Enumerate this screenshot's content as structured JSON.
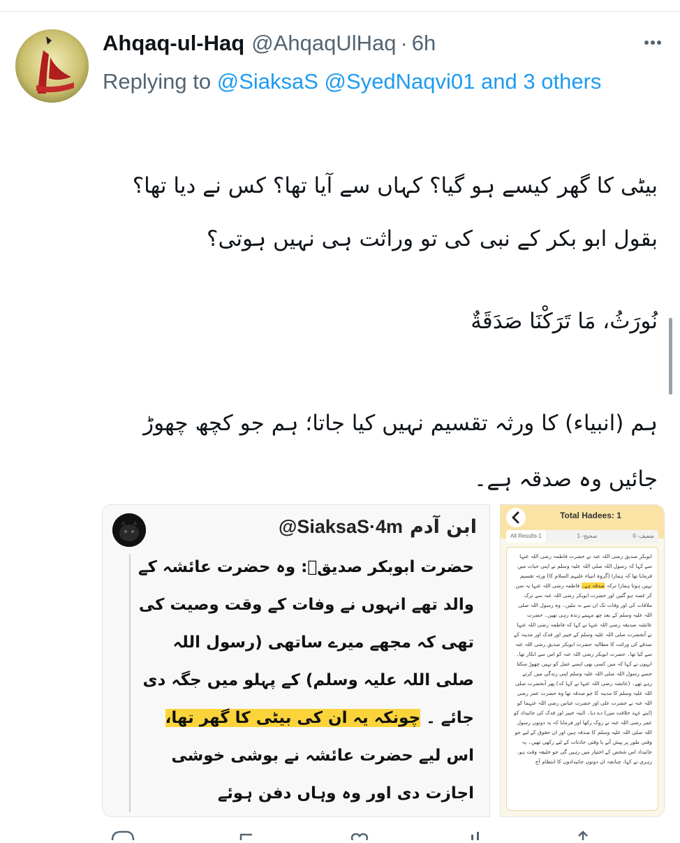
{
  "tweet": {
    "author_name": "Ahqaq-ul-Haq",
    "author_handle": "@AhqaqUlHaq",
    "separator": "·",
    "time": "6h",
    "reply_prefix": "Replying to",
    "mention_1": "@SiaksaS",
    "mention_2": "@SyedNaqvi01",
    "mention_more": "and 3 others",
    "paragraph_1": "بیٹی کا گھر کیسے ہو گیا؟ کہاں سے آیا تھا؟ کس نے دیا تھا؟ بقول ابو بکر کے نبی کی تو وراثت ہی نہیں ہوتی؟",
    "paragraph_2": "نُورَثُ، مَا تَرَكْنَا صَدَقَةٌ",
    "paragraph_3": "ہم (انبیاء) کا ورثہ تقسیم نہیں کیا جاتا؛ ہم جو کچھ چھوڑ جائیں وہ صدقہ ہے۔"
  },
  "left_image": {
    "handle": "@SiaksaS",
    "separator": "·",
    "time": "4m",
    "name": "ابن آدم",
    "body_before": "حضرت ابوبکر صدیقؓ: وہ حضرت عائشہ کے والد تھے انہوں نے وفات کے وقت وصیت کی تھی کہ مجھے میرے ساتھی (رسول اللہ صلی اللہ علیہ وسلم) کے پہلو میں جگہ دی جائے ۔",
    "body_highlight": "چونکہ یہ ان کی بیٹی کا گھر تھا،",
    "body_after": "اس لیے حضرت عائشہ نے بوشی خوشی اجازت دی اور وہ وہاں دفن ہوئے"
  },
  "right_image": {
    "title": "Total Hadees: 1",
    "tabs": [
      "All Results-1",
      "صحیح- 1",
      "ضعیف- 0"
    ],
    "text_before": "ابوبکر صدیق رضی اللہ عنہ نے حضرت فاطمہ رضی اللہ عنہا سے کہا کہ رسول اللہ صلی اللہ علیہ وسلم نے اپنی حیات میں فرمایا تھا کہ ہمارا (گروہ انبیاء علیہم السلام کا) ورثہ تقسیم نہیں ہوتا ہمارا ترکہ",
    "text_highlight": "صدقہ ہے۔",
    "text_after": "فاطمہ رضی اللہ عنہا یہ سن کر غصہ ہو گئیں اور حضرت ابوبکر رضی اللہ عنہ سے ترک ملاقات کی اور وفات تک ان سے نہ ملیں۔ وہ رسول اللہ صلی اللہ علیہ وسلم کے بعد چھ مہینے زندہ رہی تھیں۔ حضرت عائشہ صدیقہ رضی اللہ عنہا نے کہا کہ فاطمہ رضی اللہ عنہا نے آنحضرت صلی اللہ علیہ وسلم کے خیبر اور فدک اور مدینہ کے صدقے کی وراثت کا مطالبہ حضرت ابوبکر صدیق رضی اللہ عنہ سے کیا تھا۔ حضرت ابوبکر رضی اللہ عنہ کو اس سے انکار تھا۔ انہوں نے کہا کہ میں کسی بھی ایسے عمل کو نہیں چھوڑ سکتا جسے رسول اللہ صلی اللہ علیہ وسلم اپنی زندگی میں کرتے رہے تھے۔ (عائشہ رضی اللہ عنہا نے کہا کہ) پھر آنحضرت صلی اللہ علیہ وسلم کا مدینہ کا جو صدقہ تھا وہ حضرت عمر رضی اللہ عنہ نے حضرت علی اور حضرت عباس رضی اللہ عنہما کو (اپنے عہد خلافت میں) دے دیا۔ البتہ خیبر اور فدک کی جائیداد کو عمر رضی اللہ عنہ نے روک رکھا اور فرمایا کہ یہ دونوں رسول اللہ صلی اللہ علیہ وسلم کا صدقہ ہیں اور ان حقوق کے لیے جو وقتی طور پر پیش آتے یا وقتی حادثات کے لیے رکھی تھیں۔ یہ جائیداد اس شخص کے اختیار میں رہیں گی جو خلیفہ وقت ہو۔ زہری نے کہا، چنانچہ ان دونوں جائیدادوں کا انتظام آج"
  },
  "icons": {
    "more": "more-horizontal-icon",
    "back": "chevron-left-icon",
    "reply": "reply-icon",
    "retweet": "retweet-icon",
    "like": "heart-icon",
    "views": "views-icon",
    "share": "share-icon"
  },
  "colors": {
    "link": "#1d9bf0",
    "secondary": "#536471",
    "highlight": "#fbd43b"
  }
}
